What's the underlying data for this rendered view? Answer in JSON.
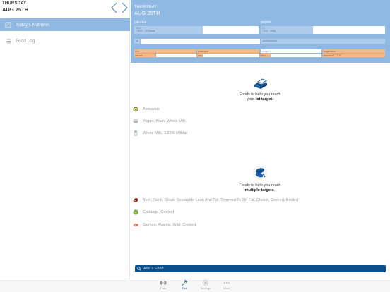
{
  "sidebar": {
    "day": "THURSDAY",
    "date": "AUG 25TH",
    "items": [
      {
        "label": "Today's Nutrition",
        "icon": "clipboard-icon",
        "active": true
      },
      {
        "label": "Food Log",
        "icon": "list-icon",
        "active": false
      }
    ]
  },
  "header": {
    "day": "THURSDAY",
    "date": "AUG 25TH",
    "calories": {
      "label": "calories",
      "value": "1537",
      "target": "/ 1180 - 2076kcal",
      "level": 0.55
    },
    "protein": {
      "label": "protein",
      "value": "69",
      "target": "/ 144 - 165g",
      "level": 0.42
    },
    "row2": {
      "left": "fat",
      "right": "carbohydrate"
    },
    "row3": [
      "fiber",
      "potassium",
      "omega-3",
      "magnesium"
    ],
    "row4": [
      "calcium",
      "iron",
      "zinc",
      "vitamin B6 + B12"
    ]
  },
  "sections": [
    {
      "icon": "butter-icon",
      "caption_prefix": "Foods to help you reach",
      "caption_mid": "your ",
      "caption_bold": "fat target",
      "caption_suffix": ".",
      "foods": [
        {
          "label": "Avocados",
          "icon": "avocado-icon"
        },
        {
          "label": "Yogurt, Plain, Whole Milk",
          "icon": "yogurt-icon"
        },
        {
          "label": "Whole Milk, 3.25% Milkfat",
          "icon": "milk-icon"
        }
      ]
    },
    {
      "icon": "targets-icon",
      "caption_prefix": "Foods to help you reach",
      "caption_mid": "",
      "caption_bold": "multiple targets",
      "caption_suffix": ".",
      "foods": [
        {
          "label": "Beef, Flank, Steak, Separable Lean And Fat, Trimmed To 0In Fat, Choice, Cooked, Broiled",
          "icon": "steak-icon"
        },
        {
          "label": "Cabbage, Cooked",
          "icon": "cabbage-icon"
        },
        {
          "label": "Salmon, Atlantic, Wild, Cooked",
          "icon": "salmon-icon"
        }
      ]
    }
  ],
  "add_food": {
    "placeholder": "Add a Food"
  },
  "tabs": [
    {
      "label": "Train",
      "icon": "dumbbell-icon",
      "active": false
    },
    {
      "label": "Eat",
      "icon": "fork-icon",
      "active": true
    },
    {
      "label": "Settings",
      "icon": "gear-icon",
      "active": false
    },
    {
      "label": "More",
      "icon": "more-icon",
      "active": false
    }
  ],
  "colors": {
    "accent": "#8fb8e3",
    "brand_dark": "#0d4f8b",
    "warning": "#f5b887"
  }
}
